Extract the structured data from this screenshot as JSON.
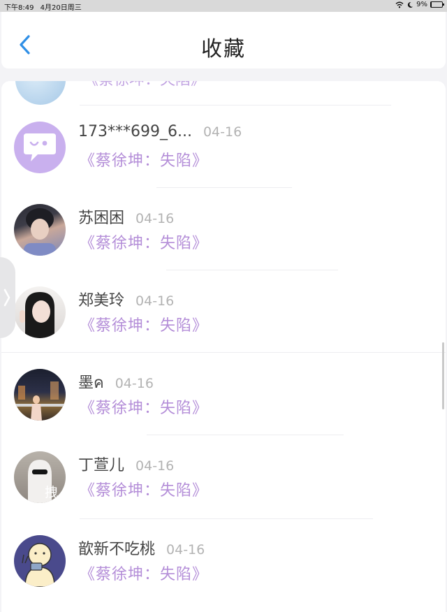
{
  "status_bar": {
    "time": "下午8:49",
    "date": "4月20日周三",
    "battery": "9%",
    "battery_level": 0.09,
    "icons": [
      "wifi-icon",
      "moon-icon",
      "battery-icon"
    ]
  },
  "nav": {
    "title": "收藏",
    "back_icon": "chevron-left-icon"
  },
  "list": {
    "partial_item": {
      "book": "《蔡徐坤：失陷》"
    },
    "items": [
      {
        "name": "173***699_6...",
        "date": "04-16",
        "book": "《蔡徐坤：失陷》",
        "avatar": "default-chat-avatar"
      },
      {
        "name": "苏困困",
        "date": "04-16",
        "book": "《蔡徐坤：失陷》",
        "avatar": "photo-avatar"
      },
      {
        "name": "郑美玲",
        "date": "04-16",
        "book": "《蔡徐坤：失陷》",
        "avatar": "photo-avatar"
      },
      {
        "name": "墨ค",
        "date": "04-16",
        "book": "《蔡徐坤：失陷》",
        "avatar": "photo-avatar"
      },
      {
        "name": "丁萱儿",
        "date": "04-16",
        "book": "《蔡徐坤：失陷》",
        "avatar": "photo-avatar",
        "avatar_text": "拽"
      },
      {
        "name": "歆新不吃桃",
        "date": "04-16",
        "book": "《蔡徐坤：失陷》",
        "avatar": "cartoon-avatar"
      }
    ]
  },
  "colors": {
    "accent_blue": "#2f8fe6",
    "book_purple": "#b48ed8",
    "chat_avatar_bg": "#c9b0ee",
    "date_gray": "#b3b3b3"
  }
}
